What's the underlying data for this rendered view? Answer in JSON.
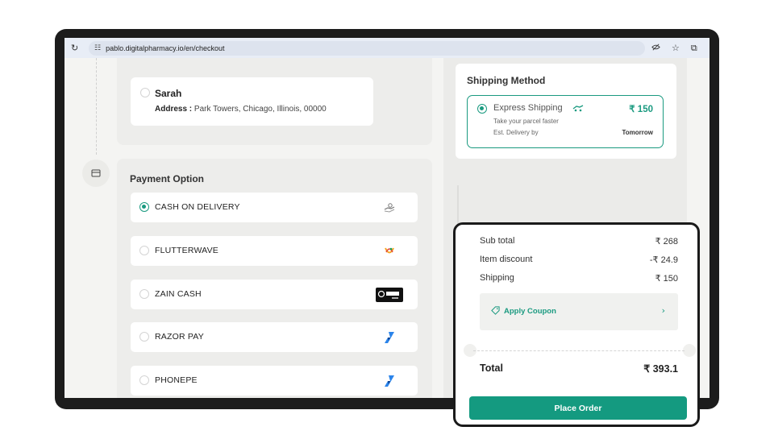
{
  "browser": {
    "url": "pablo.digitalpharmacy.io/en/checkout"
  },
  "address": {
    "name": "Sarah",
    "address_label": "Address :",
    "address_value": "Park Towers, Chicago, Illinois, 00000"
  },
  "payment": {
    "title": "Payment Option",
    "options": [
      {
        "label": "CASH ON DELIVERY",
        "selected": true,
        "icon": "cash-hand-icon"
      },
      {
        "label": "FLUTTERWAVE",
        "selected": false,
        "icon": "flutterwave-logo"
      },
      {
        "label": "ZAIN CASH",
        "selected": false,
        "icon": "zain-cash-logo"
      },
      {
        "label": "RAZOR PAY",
        "selected": false,
        "icon": "razorpay-logo"
      },
      {
        "label": "PHONEPE",
        "selected": false,
        "icon": "razorpay-logo"
      }
    ]
  },
  "shipping": {
    "title": "Shipping Method",
    "option_name": "Express Shipping",
    "price": "₹ 150",
    "description": "Take your parcel faster",
    "eta_label": "Est. Delivery by",
    "eta_value": "Tomorrow"
  },
  "summary": {
    "rows": [
      {
        "label": "Sub total",
        "value": "₹ 268"
      },
      {
        "label": "Item discount",
        "value": "-₹ 24.9"
      },
      {
        "label": "Shipping",
        "value": "₹ 150"
      }
    ],
    "coupon_label": "Apply Coupon",
    "total_label": "Total",
    "total_value": "₹ 393.1",
    "place_order_label": "Place Order"
  },
  "colors": {
    "accent": "#149a80",
    "frame": "#1c1c1c"
  }
}
